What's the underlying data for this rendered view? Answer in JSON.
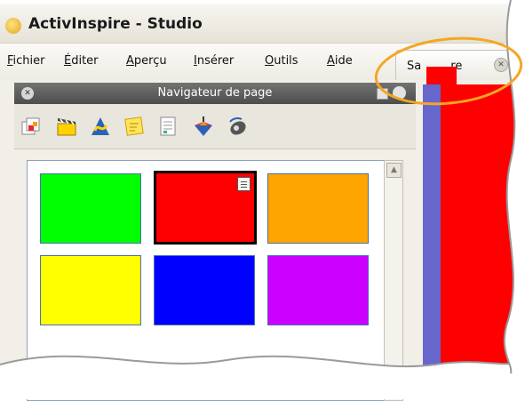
{
  "window": {
    "title": "ActivInspire - Studio"
  },
  "menu": [
    {
      "label": "Fichier",
      "underline": "F",
      "rest": "ichier"
    },
    {
      "label": "Éditer",
      "underline": "É",
      "rest": "diter"
    },
    {
      "label": "Aperçu",
      "underline": "A",
      "rest": "perçu"
    },
    {
      "label": "Insérer",
      "underline": "I",
      "rest": "nsérer"
    },
    {
      "label": "Outils",
      "underline": "O",
      "rest": "utils"
    },
    {
      "label": "Aide",
      "underline": "A",
      "rest": "ide"
    }
  ],
  "tab": {
    "label": "Sa        re"
  },
  "panel": {
    "title": "Navigateur de page"
  },
  "toolbar_icons": [
    "page-browser-icon",
    "resource-browser-icon",
    "property-browser-icon",
    "notes-browser-icon",
    "object-browser-icon",
    "spinner-icon",
    "voting-icon"
  ],
  "thumbnails": [
    {
      "color": "#00ff00",
      "selected": false
    },
    {
      "color": "#ff0000",
      "selected": true
    },
    {
      "color": "#ffa500",
      "selected": false
    },
    {
      "color": "#ffff00",
      "selected": false
    },
    {
      "color": "#0000ff",
      "selected": false
    },
    {
      "color": "#cc00ff",
      "selected": false
    }
  ],
  "colors": {
    "highlight": "#f5a623",
    "panel_header": "#5e5e5e",
    "strip_blue": "#6666cc",
    "strip_red": "#ff0000"
  }
}
